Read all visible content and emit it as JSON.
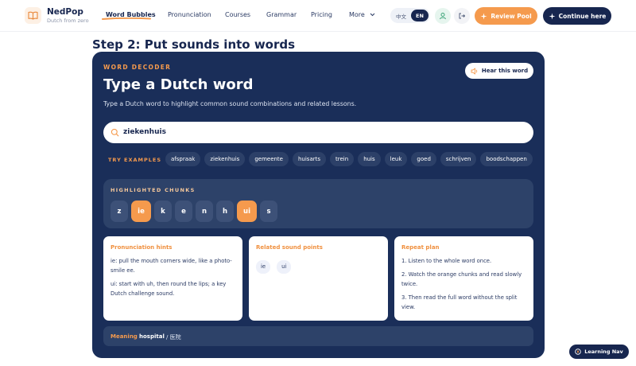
{
  "brand": {
    "name": "NedPop",
    "tagline": "Dutch from zero"
  },
  "nav": {
    "links": [
      "Word Bubbles",
      "Pronunciation",
      "Courses",
      "Grammar",
      "Pricing",
      "More"
    ],
    "active_index": 0,
    "lang_zh": "中文",
    "lang_en": "EN",
    "review_label": "Review Pool",
    "continue_label": "Continue here"
  },
  "page": {
    "step_title": "Step 2: Put sounds into words"
  },
  "decoder": {
    "eyebrow": "WORD DECODER",
    "title": "Type a Dutch word",
    "description": "Type a Dutch word to highlight common sound combinations and related lessons.",
    "hear_label": "Hear this word",
    "search_value": "ziekenhuis",
    "try_label": "TRY EXAMPLES",
    "examples": [
      "afspraak",
      "ziekenhuis",
      "gemeente",
      "huisarts",
      "trein",
      "huis",
      "leuk",
      "goed",
      "schrijven",
      "boodschappen"
    ],
    "highlight_title": "HIGHLIGHTED CHUNKS",
    "chunks": [
      {
        "text": "z",
        "hot": false
      },
      {
        "text": "ie",
        "hot": true
      },
      {
        "text": "k",
        "hot": false
      },
      {
        "text": "e",
        "hot": false
      },
      {
        "text": "n",
        "hot": false
      },
      {
        "text": "h",
        "hot": false
      },
      {
        "text": "ui",
        "hot": true
      },
      {
        "text": "s",
        "hot": false
      }
    ],
    "hints_title": "Pronunciation hints",
    "hints": [
      "ie: pull the mouth corners wide, like a photo-smile ee.",
      "ui: start with uh, then round the lips; a key Dutch challenge sound."
    ],
    "related_title": "Related sound points",
    "related": [
      "ie",
      "ui"
    ],
    "repeat_title": "Repeat plan",
    "repeat": [
      "1. Listen to the whole word once.",
      "2. Watch the orange chunks and read slowly twice.",
      "3. Then read the full word without the split view."
    ],
    "meaning_label": "Meaning",
    "meaning_value": "hospital",
    "meaning_cn": "/ 医院"
  },
  "learning_nav_label": "Learning Nav",
  "colors": {
    "accent": "#f59a4d",
    "navy": "#17264f",
    "card": "#1a2e59"
  }
}
